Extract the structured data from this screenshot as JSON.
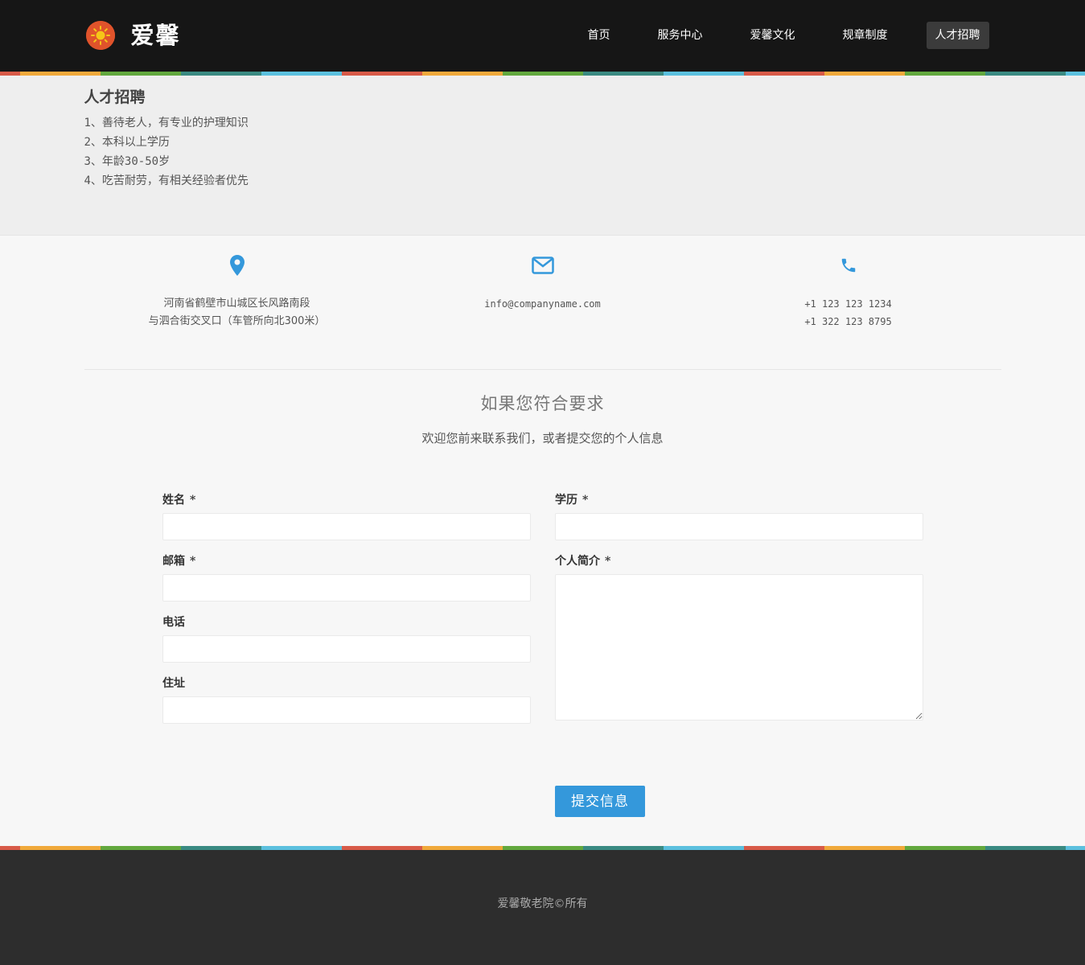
{
  "header": {
    "logo_text": "爱馨",
    "nav": [
      {
        "label": "首页"
      },
      {
        "label": "服务中心"
      },
      {
        "label": "爱馨文化"
      },
      {
        "label": "规章制度"
      },
      {
        "label": "人才招聘",
        "active": true
      }
    ]
  },
  "recruit": {
    "title": "人才招聘",
    "items": [
      "1、善待老人，有专业的护理知识",
      "2、本科以上学历",
      "3、年龄30-50岁",
      "4、吃苦耐劳，有相关经验者优先"
    ]
  },
  "contact": {
    "address": [
      "河南省鹤壁市山城区长风路南段",
      "与泗合街交叉口（车管所向北300米）"
    ],
    "email": "info@companyname.com",
    "phones": [
      "+1 123 123 1234",
      "+1 322 123 8795"
    ],
    "icon_color": "#3498db"
  },
  "apply": {
    "title": "如果您符合要求",
    "subtitle": "欢迎您前来联系我们，或者提交您的个人信息"
  },
  "form": {
    "name_label": "姓名",
    "education_label": "学历",
    "email_label": "邮箱",
    "bio_label": "个人简介",
    "phone_label": "电话",
    "address_label": "住址",
    "required_mark": "*",
    "submit_label": "提交信息"
  },
  "footer": {
    "text": "爱馨敬老院©所有"
  },
  "colors": {
    "header_bg": "#161616",
    "accent": "#3498db",
    "footer_bg": "#2d2d2d"
  }
}
